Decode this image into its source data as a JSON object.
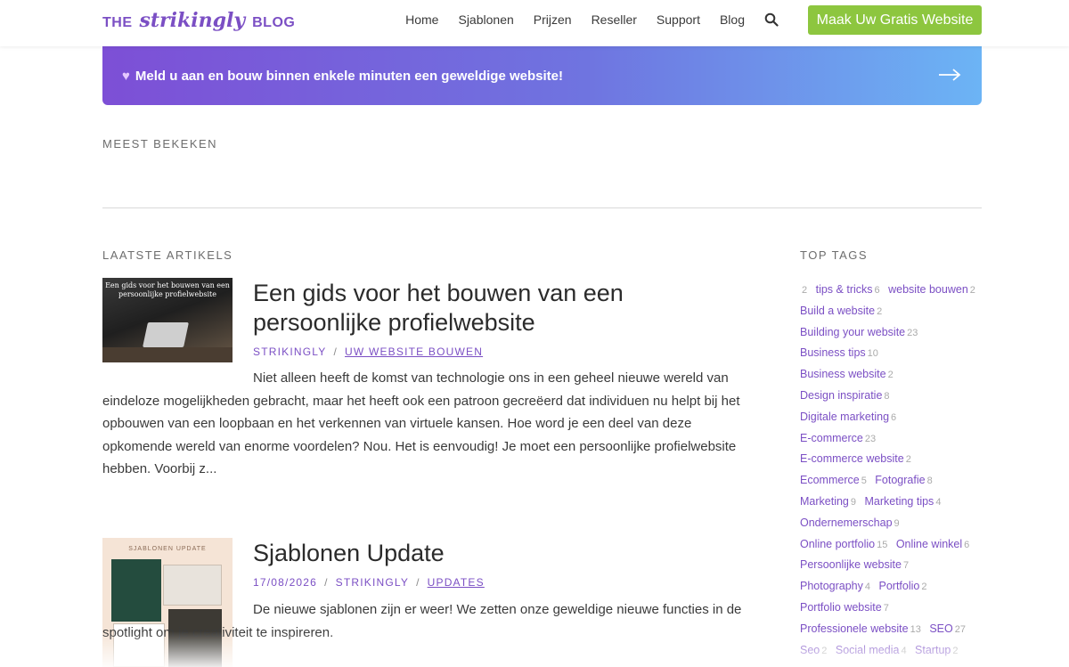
{
  "header": {
    "logo": {
      "prefix": "THE",
      "brand": "strikingly",
      "suffix": "BLOG"
    },
    "nav": [
      "Home",
      "Sjablonen",
      "Prijzen",
      "Reseller",
      "Support",
      "Blog"
    ],
    "cta": "Maak Uw Gratis Website"
  },
  "banner": {
    "icon": "purple-heart",
    "text": "Meld u aan en bouw binnen enkele minuten een geweldige website!"
  },
  "most_viewed": {
    "label": "MEEST BEKEKEN"
  },
  "latest": {
    "label": "LAATSTE ARTIKELS",
    "articles": [
      {
        "image_caption": "Een gids voor het bouwen van een persoonlijke profielwebsite",
        "title": "Een gids voor het bouwen van een persoonlijke profielwebsite",
        "meta": [
          "STRIKINGLY",
          "UW WEBSITE BOUWEN"
        ],
        "excerpt": "Niet alleen heeft de komst van technologie ons in een geheel nieuwe wereld van eindeloze mogelijkheden gebracht, maar het heeft ook een patroon gecreëerd dat individuen nu helpt bij het opbouwen van een loopbaan en het verkennen van virtuele kansen. Hoe word je een deel van deze opkomende wereld van enorme voordelen? Nou. Het is eenvoudig! Je moet een persoonlijke profielwebsite hebben. Voorbij z..."
      },
      {
        "image_caption": "SJABLONEN UPDATE",
        "title": "Sjablonen Update",
        "meta": [
          "17/08/2026",
          "STRIKINGLY",
          "UPDATES"
        ],
        "excerpt": "De nieuwe sjablonen zijn er weer! We zetten onze geweldige nieuwe functies in de spotlight om je creativiteit te inspireren."
      }
    ]
  },
  "top_tags": {
    "label": "TOP TAGS",
    "items": [
      {
        "name": "",
        "count": "2"
      },
      {
        "name": "tips & tricks",
        "count": "6"
      },
      {
        "name": "website bouwen",
        "count": "2"
      },
      {
        "name": "Build a website",
        "count": "2"
      },
      {
        "name": "Building your website",
        "count": "23"
      },
      {
        "name": "Business tips",
        "count": "10"
      },
      {
        "name": "Business website",
        "count": "2"
      },
      {
        "name": "Design inspiratie",
        "count": "8"
      },
      {
        "name": "Digitale marketing",
        "count": "6"
      },
      {
        "name": "E-commerce",
        "count": "23"
      },
      {
        "name": "E-commerce website",
        "count": "2"
      },
      {
        "name": "Ecommerce",
        "count": "5"
      },
      {
        "name": "Fotografie",
        "count": "8"
      },
      {
        "name": "Marketing",
        "count": "9"
      },
      {
        "name": "Marketing tips",
        "count": "4"
      },
      {
        "name": "Ondernemerschap",
        "count": "9"
      },
      {
        "name": "Online portfolio",
        "count": "15"
      },
      {
        "name": "Online winkel",
        "count": "6"
      },
      {
        "name": "Persoonlijke website",
        "count": "7"
      },
      {
        "name": "Photography",
        "count": "4"
      },
      {
        "name": "Portfolio",
        "count": "2"
      },
      {
        "name": "Portfolio website",
        "count": "7"
      },
      {
        "name": "Professionele website",
        "count": "13"
      },
      {
        "name": "SEO",
        "count": "27"
      },
      {
        "name": "Seo",
        "count": "2"
      },
      {
        "name": "Social media",
        "count": "4"
      },
      {
        "name": "Startup",
        "count": "2"
      }
    ]
  },
  "colors": {
    "accent": "#7b4fc4",
    "cta": "#8dc63f",
    "banner_start": "#7d4fd6",
    "banner_end": "#6cb4f5"
  }
}
